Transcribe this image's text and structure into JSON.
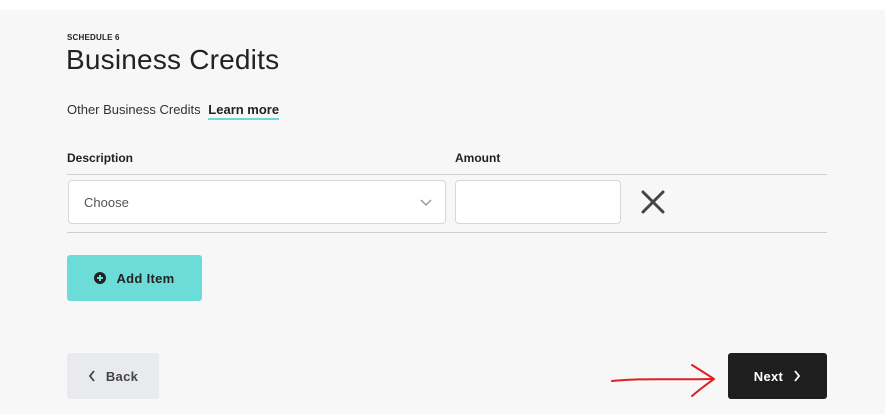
{
  "header": {
    "kicker": "SCHEDULE 6",
    "title": "Business Credits"
  },
  "subtitle": {
    "text": "Other Business Credits",
    "learn_more": "Learn more"
  },
  "table": {
    "columns": [
      "Description",
      "Amount"
    ],
    "rows": [
      {
        "description_value": "Choose",
        "amount_value": ""
      }
    ]
  },
  "actions": {
    "add_item_label": "Add Item",
    "back_label": "Back",
    "next_label": "Next"
  },
  "colors": {
    "accent": "#6cdcd8",
    "primary_button": "#1e1e1e",
    "annotation": "#e02020"
  },
  "icons": {
    "select_chevron": "chevron-down-icon",
    "remove_row": "close-icon",
    "add_item": "plus-circle-icon",
    "back": "chevron-left-icon",
    "next": "chevron-right-icon",
    "annotation": "hand-drawn-arrow-icon"
  }
}
